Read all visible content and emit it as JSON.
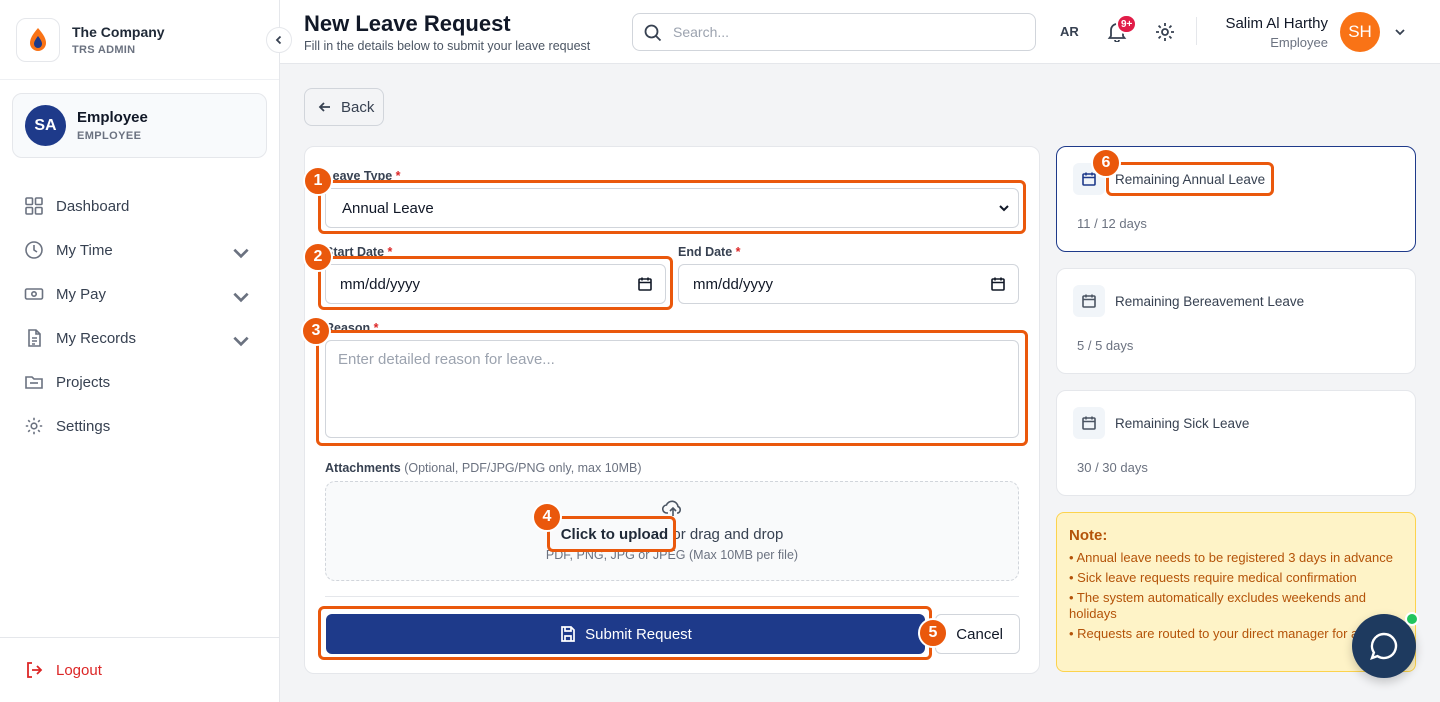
{
  "brand": {
    "name": "The Company",
    "subtitle": "TRS ADMIN"
  },
  "user_card": {
    "initials": "SA",
    "name": "Employee",
    "role": "EMPLOYEE"
  },
  "nav": [
    {
      "label": "Dashboard",
      "icon": "dashboard-icon"
    },
    {
      "label": "My Time",
      "icon": "clock-icon",
      "expandable": true
    },
    {
      "label": "My Pay",
      "icon": "money-icon",
      "expandable": true
    },
    {
      "label": "My Records",
      "icon": "document-icon",
      "expandable": true
    },
    {
      "label": "Projects",
      "icon": "folder-icon"
    },
    {
      "label": "Settings",
      "icon": "gear-icon"
    }
  ],
  "logout_label": "Logout",
  "header": {
    "title": "New Leave Request",
    "subtitle": "Fill in the details below to submit your leave request",
    "search_placeholder": "Search...",
    "language": "AR",
    "notification_count": "9+",
    "user_name": "Salim Al Harthy",
    "user_role": "Employee",
    "user_initials": "SH"
  },
  "back_label": "Back",
  "form": {
    "leave_type_label": "Leave Type",
    "leave_type_value": "Annual Leave",
    "start_date_label": "Start Date",
    "start_date_value": "mm/dd/yyyy",
    "end_date_label": "End Date",
    "end_date_value": "mm/dd/yyyy",
    "reason_label": "Reason",
    "reason_placeholder": "Enter detailed reason for leave...",
    "required_mark": "*",
    "attachments_label": "Attachments",
    "attachments_hint": "(Optional, PDF/JPG/PNG only, max 10MB)",
    "upload_link": "Click to upload",
    "upload_text": "or drag and drop",
    "upload_sub": "PDF, PNG, JPG or JPEG (Max 10MB per file)",
    "submit_label": "Submit Request",
    "cancel_label": "Cancel"
  },
  "balances": [
    {
      "title": "Remaining Annual Leave",
      "value": "11 / 12 days",
      "active": true
    },
    {
      "title": "Remaining Bereavement Leave",
      "value": "5 / 5 days"
    },
    {
      "title": "Remaining Sick Leave",
      "value": "30 / 30 days"
    }
  ],
  "note": {
    "title": "Note:",
    "items": [
      "• Annual leave needs to be registered 3 days in advance",
      "• Sick leave requests require medical confirmation",
      "• The system automatically excludes weekends and holidays",
      "• Requests are routed to your direct manager for approval"
    ]
  },
  "annotations": [
    "1",
    "2",
    "3",
    "4",
    "5",
    "6"
  ],
  "colors": {
    "primary": "#1e3a8a",
    "accent": "#f97316",
    "annotation": "#ea580c",
    "danger": "#dc2626",
    "note_bg": "#fef3c7"
  }
}
